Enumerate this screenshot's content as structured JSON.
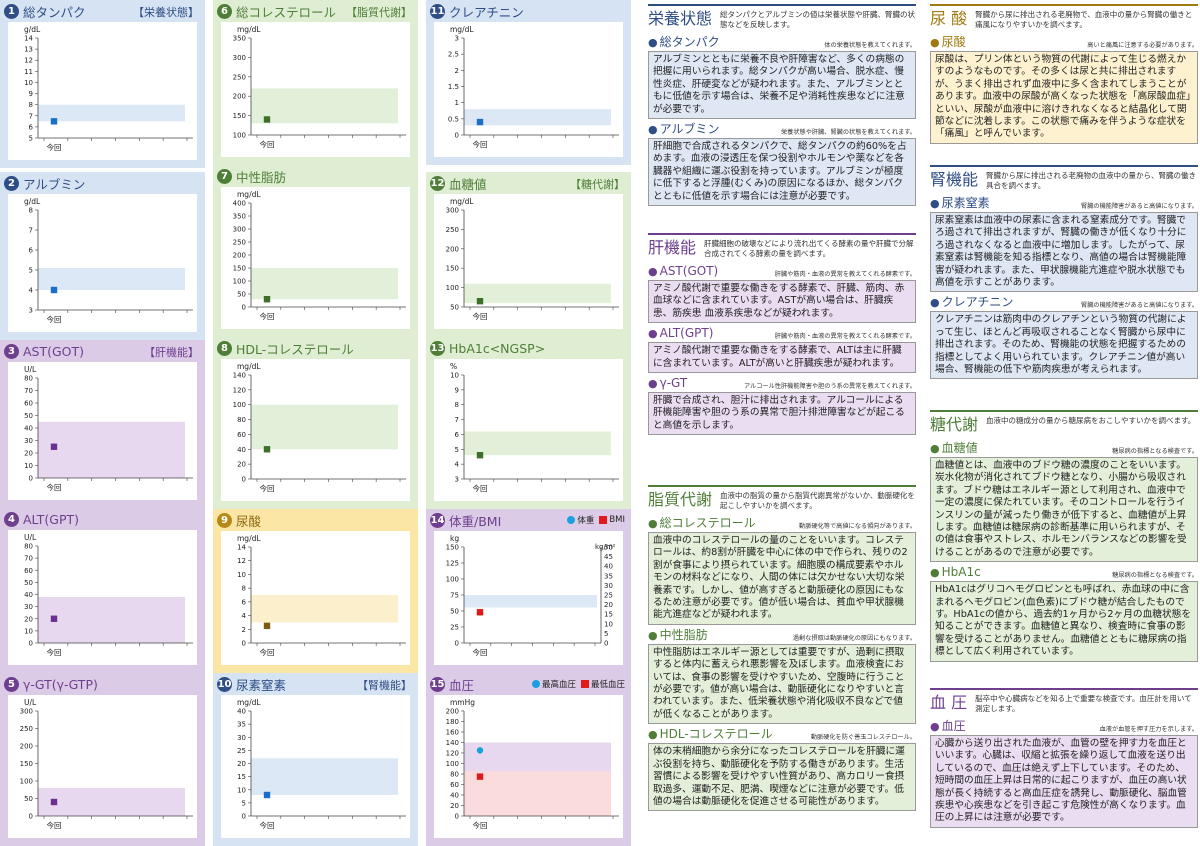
{
  "colors": {
    "blue": "#2f4e86",
    "blue_bg": "#d6e3f3",
    "blue_band": "#dce8f5",
    "green": "#4f7e38",
    "green_bg": "#dfeed3",
    "green_band": "#e3f0d9",
    "purple": "#6f3f8f",
    "purple_bg": "#dccbe6",
    "purple_band": "#e7d8ef",
    "yellow": "#b58a18",
    "yellow_bg": "#fce6a6",
    "yellow_band": "#fcefcc",
    "pink_band": "#fbdcdc",
    "point_blue": "#1a6fc8",
    "point_green": "#3d6e2a",
    "point_purple": "#6a3090",
    "point_brown": "#7a5a10",
    "marker_cyan": "#1aa0e0",
    "marker_red": "#e01a1a"
  },
  "x_label": "今回",
  "tiles": [
    {
      "num": "1",
      "title": "総タンパク",
      "category": "【栄養状態】",
      "unit": "g/dL",
      "color": "blue",
      "chart_data": {
        "type": "scatter",
        "ylim": [
          5,
          14
        ],
        "ticks": [
          5,
          6,
          7,
          8,
          9,
          10,
          11,
          12,
          13,
          14
        ],
        "band": [
          6.5,
          8.0
        ],
        "points": [
          {
            "x": "今回",
            "y": 6.5
          }
        ]
      }
    },
    {
      "num": "2",
      "title": "アルブミン",
      "category": "",
      "unit": "g/dL",
      "color": "blue",
      "chart_data": {
        "type": "scatter",
        "ylim": [
          3,
          8
        ],
        "ticks": [
          3,
          4,
          5,
          6,
          7,
          8
        ],
        "band": [
          4.0,
          5.1
        ],
        "points": [
          {
            "x": "今回",
            "y": 4.0
          }
        ]
      }
    },
    {
      "num": "3",
      "title": "AST(GOT)",
      "category": "【肝機能】",
      "unit": "U/L",
      "color": "purple",
      "chart_data": {
        "type": "scatter",
        "ylim": [
          0,
          80
        ],
        "ticks": [
          0,
          10,
          20,
          30,
          40,
          50,
          60,
          70,
          80
        ],
        "band": [
          0,
          45
        ],
        "points": [
          {
            "x": "今回",
            "y": 25
          }
        ]
      }
    },
    {
      "num": "4",
      "title": "ALT(GPT)",
      "category": "",
      "unit": "U/L",
      "color": "purple",
      "chart_data": {
        "type": "scatter",
        "ylim": [
          0,
          80
        ],
        "ticks": [
          0,
          10,
          20,
          30,
          40,
          50,
          60,
          70,
          80
        ],
        "band": [
          0,
          38
        ],
        "points": [
          {
            "x": "今回",
            "y": 20
          }
        ]
      }
    },
    {
      "num": "5",
      "title": "γ-GT(γ-GTP)",
      "category": "",
      "unit": "U/L",
      "color": "purple",
      "chart_data": {
        "type": "scatter",
        "ylim": [
          0,
          300
        ],
        "ticks": [
          0,
          50,
          100,
          150,
          200,
          250,
          300
        ],
        "band": [
          0,
          80
        ],
        "points": [
          {
            "x": "今回",
            "y": 40
          }
        ]
      }
    },
    {
      "num": "6",
      "title": "総コレステロール",
      "category": "【脂質代謝】",
      "unit": "mg/dL",
      "color": "green",
      "chart_data": {
        "type": "scatter",
        "ylim": [
          100,
          350
        ],
        "ticks": [
          100,
          150,
          200,
          250,
          300,
          350
        ],
        "band": [
          130,
          220
        ],
        "points": [
          {
            "x": "今回",
            "y": 140
          }
        ]
      }
    },
    {
      "num": "7",
      "title": "中性脂肪",
      "category": "",
      "unit": "mg/dL",
      "color": "green",
      "chart_data": {
        "type": "scatter",
        "ylim": [
          0,
          400
        ],
        "ticks": [
          0,
          50,
          100,
          150,
          200,
          250,
          300,
          350,
          400
        ],
        "band": [
          30,
          150
        ],
        "points": [
          {
            "x": "今回",
            "y": 30
          }
        ]
      }
    },
    {
      "num": "8",
      "title": "HDL-コレステロール",
      "category": "",
      "unit": "mg/dL",
      "color": "green",
      "chart_data": {
        "type": "scatter",
        "ylim": [
          0,
          140
        ],
        "ticks": [
          0,
          20,
          40,
          60,
          80,
          100,
          120,
          140
        ],
        "band": [
          40,
          100
        ],
        "points": [
          {
            "x": "今回",
            "y": 40
          }
        ]
      }
    },
    {
      "num": "9",
      "title": "尿酸",
      "category": "",
      "unit": "mg/dL",
      "color": "yellow",
      "chart_data": {
        "type": "scatter",
        "ylim": [
          0,
          14
        ],
        "ticks": [
          0,
          2,
          4,
          6,
          8,
          10,
          12,
          14
        ],
        "band": [
          3.0,
          7.0
        ],
        "points": [
          {
            "x": "今回",
            "y": 2.5
          }
        ]
      }
    },
    {
      "num": "10",
      "title": "尿素窒素",
      "category": "【腎機能】",
      "unit": "mg/dL",
      "color": "blue",
      "chart_data": {
        "type": "scatter",
        "ylim": [
          0,
          40
        ],
        "ticks": [
          0,
          5,
          10,
          15,
          20,
          25,
          30,
          35,
          40
        ],
        "band": [
          8,
          22
        ],
        "points": [
          {
            "x": "今回",
            "y": 8
          }
        ]
      }
    },
    {
      "num": "11",
      "title": "クレアチニン",
      "category": "",
      "unit": "mg/dL",
      "color": "blue",
      "chart_data": {
        "type": "scatter",
        "ylim": [
          0,
          3
        ],
        "ticks": [
          0,
          0.5,
          1,
          1.5,
          2,
          2.5,
          3
        ],
        "band": [
          0.3,
          0.8
        ],
        "points": [
          {
            "x": "今回",
            "y": 0.4
          }
        ]
      }
    },
    {
      "num": "12",
      "title": "血糖値",
      "category": "【糖代謝】",
      "unit": "mg/dL",
      "color": "green",
      "chart_data": {
        "type": "scatter",
        "ylim": [
          50,
          300
        ],
        "ticks": [
          50,
          100,
          150,
          200,
          250,
          300
        ],
        "band": [
          60,
          110
        ],
        "points": [
          {
            "x": "今回",
            "y": 65
          }
        ]
      }
    },
    {
      "num": "13",
      "title": "HbA1c<NGSP>",
      "category": "",
      "unit": "%",
      "color": "green",
      "chart_data": {
        "type": "scatter",
        "ylim": [
          3,
          10
        ],
        "ticks": [
          3,
          4,
          5,
          6,
          7,
          8,
          9,
          10
        ],
        "band": [
          4.6,
          6.2
        ],
        "points": [
          {
            "x": "今回",
            "y": 4.6
          }
        ]
      }
    },
    {
      "num": "14",
      "title": "体重/BMI",
      "category": "",
      "unit": "kg",
      "unit_right": "kg/m²",
      "color": "purple",
      "legend": [
        {
          "label": "体重",
          "shape": "circle",
          "color": "#1aa0e0"
        },
        {
          "label": "BMI",
          "shape": "square",
          "color": "#e01a1a"
        }
      ],
      "chart_data": {
        "type": "scatter",
        "ylim": [
          0,
          150
        ],
        "ticks": [
          0,
          25,
          50,
          75,
          100,
          125,
          150
        ],
        "y2lim": [
          0,
          50
        ],
        "ticks2": [
          0,
          5,
          10,
          15,
          20,
          25,
          30,
          35,
          40,
          45,
          50
        ],
        "band2": [
          18.5,
          25
        ],
        "points": [
          {
            "x": "今回",
            "y": 48,
            "series": "体重"
          },
          {
            "x": "今回",
            "y2": 16,
            "series": "BMI"
          }
        ]
      }
    },
    {
      "num": "15",
      "title": "血圧",
      "category": "",
      "unit": "mmHg",
      "color": "purple",
      "legend": [
        {
          "label": "最高血圧",
          "shape": "circle",
          "color": "#1aa0e0"
        },
        {
          "label": "最低血圧",
          "shape": "square",
          "color": "#e01a1a"
        }
      ],
      "chart_data": {
        "type": "scatter",
        "ylim": [
          0,
          200
        ],
        "ticks": [
          0,
          20,
          40,
          60,
          80,
          100,
          120,
          140,
          160,
          180,
          200
        ],
        "band": [
          0,
          140
        ],
        "band_low": [
          0,
          85
        ],
        "points": [
          {
            "x": "今回",
            "y": 125,
            "series": "最高血圧"
          },
          {
            "x": "今回",
            "y": 75,
            "series": "最低血圧"
          }
        ]
      }
    }
  ],
  "sections": {
    "nutrition": {
      "title": "栄養状態",
      "desc": "総タンパクとアルブミンの値は栄養状態や肝臓、腎臓の状態などを反映します。",
      "items": [
        {
          "name": "総タンパク",
          "note": "体の栄養状態を教えてくれます。",
          "body": "アルブミンとともに栄養不良や肝障害など、多くの病態の把握に用いられます。総タンパクが高い場合、脱水症、慢性炎症、肝硬変などが疑われます。また、アルブミンとともに低値を示す場合は、栄養不足や消耗性疾患などに注意が必要です。"
        },
        {
          "name": "アルブミン",
          "note": "栄養状態や肝臓、腎臓の状態を教えてくれます。",
          "body": "肝細胞で合成されるタンパクで、総タンパクの約60%を占めます。血液の浸透圧を保つ役割やホルモンや薬などを各臓器や組織に運ぶ役割を持っています。アルブミンが極度に低下すると浮腫(むくみ)の原因になるほか、総タンパクとともに低値を示す場合には注意が必要です。"
        }
      ]
    },
    "liver": {
      "title": "肝機能",
      "desc": "肝臓細胞の破壊などにより流れ出てくる酵素の量や肝臓で分解合成されてくる酵素の量を調べます。",
      "items": [
        {
          "name": "AST(GOT)",
          "note": "肝臓や筋肉・血液の異常を教えてくれる酵素です。",
          "body": "アミノ酸代謝で重要な働きをする酵素で、肝臓、筋肉、赤血球などに含まれています。ASTが高い場合は、肝臓疾患、筋疾患 血液系疾患などが疑われます。"
        },
        {
          "name": "ALT(GPT)",
          "note": "肝臓や筋肉・血液の異常を教えてくれる酵素です。",
          "body": "アミノ酸代謝で重要な働きをする酵素で、ALTは主に肝臓に含まれています。ALTが高いと肝臓疾患が疑われます。"
        },
        {
          "name": "γ-GT",
          "note": "アルコール性肝機能障害や胆のう系の異常を教えてくれます。",
          "body": "肝臓で合成され、胆汁に排出されます。アルコールによる肝機能障害や胆のう系の異常で胆汁排泄障害などが起こると高値を示します。"
        }
      ]
    },
    "lipid": {
      "title": "脂質代謝",
      "desc": "血液中の脂質の量から脂質代謝異常がないか、動脈硬化を起こしやすいかを調べます。",
      "items": [
        {
          "name": "総コレステロール",
          "note": "動脈硬化等で高値になる傾向があります。",
          "body": "血液中のコレステロールの量のことをいいます。コレステロールは、約8割が肝臓を中心に体の中で作られ、残りの2割が食事により摂られています。細胞膜の構成要素やホルモンの材料などになり、人間の体には欠かせない大切な栄養素です。しかし、値が高すぎると動脈硬化の原因にもなるため注意が必要です。値が低い場合は、貧血や甲状腺機能亢進症などが疑われます。"
        },
        {
          "name": "中性脂肪",
          "note": "過剰な摂取は動脈硬化の原因にもなります。",
          "body": "中性脂肪はエネルギー源としては重要ですが、過剰に摂取すると体内に蓄えられ悪影響を及ぼします。血液検査においては、食事の影響を受けやすいため、空腹時に行うことが必要です。値が高い場合は、動脈硬化になりやすいと言われています。また、低栄養状態や消化吸収不良などで値が低くなることがあります。"
        },
        {
          "name": "HDL-コレステロール",
          "note": "動脈硬化を防ぐ善玉コレステロール。",
          "body": "体の末梢細胞から余分になったコレステロールを肝臓に運ぶ役割を持ち、動脈硬化を予防する働きがあります。生活習慣による影響を受けやすい性質があり、高カロリー食摂取過多、運動不足、肥満、喫煙などに注意が必要です。低値の場合は動脈硬化を促進させる可能性があります。"
        }
      ]
    },
    "uric": {
      "title": "尿 酸",
      "desc": "腎臓から尿に排出される老廃物で、血液中の量から腎臓の働きと痛風になりやすいかを調べます。",
      "items": [
        {
          "name": "尿酸",
          "note": "高いと痛風に注意する必要があります。",
          "body": "尿酸は、プリン体という物質の代謝によって生じる燃えかすのようなものです。その多くは尿と共に排出されますが、うまく排出されず血液中に多く含まれてしまうことがあります。血液中の尿酸が高くなった状態を「高尿酸血症」といい、尿酸が血液中に溶けきれなくなると結晶化して関節などに沈着します。この状態で痛みを伴うような症状を「痛風」と呼んでいます。"
        }
      ]
    },
    "kidney": {
      "title": "腎機能",
      "desc": "腎臓から尿に排出される老廃物の血液中の量から、腎臓の働き具合を調べます。",
      "items": [
        {
          "name": "尿素窒素",
          "note": "腎臓の機能障害があると高値になります。",
          "body": "尿素窒素は血液中の尿素に含まれる窒素成分です。腎臓でろ過されて排出されますが、腎臓の働きが低くなり十分にろ過されなくなると血液中に増加します。したがって、尿素窒素は腎機能を知る指標となり、高値の場合は腎機能障害が疑われます。また、甲状腺機能亢進症や脱水状態でも高値を示すことがあります。"
        },
        {
          "name": "クレアチニン",
          "note": "腎臓の機能障害があると高値になります。",
          "body": "クレアチニンは筋肉中のクレアチンという物質の代謝によって生じ、ほとんど再吸収されることなく腎臓から尿中に排出されます。そのため、腎機能の状態を把握するための指標としてよく用いられています。クレアチニン値が高い場合、腎機能の低下や筋肉疾患が考えられます。"
        }
      ]
    },
    "sugar": {
      "title": "糖代謝",
      "desc": "血液中の糖成分の量から糖尿病をおこしやすいかを調べます。",
      "items": [
        {
          "name": "血糖値",
          "note": "糖尿病の指標となる検査です。",
          "body": "血糖値とは、血液中のブドウ糖の濃度のことをいいます。炭水化物が消化されてブドウ糖となり、小腸から吸収されます。ブドウ糖はエネルギー源として利用され、血液中で一定の濃度に保たれています。そのコントロールを行うインスリンの量が減ったり働きが低下すると、血糖値が上昇します。血糖値は糖尿病の診断基準に用いられますが、その値は食事やストレス、ホルモンバランスなどの影響を受けることがあるので注意が必要です。"
        },
        {
          "name": "HbA1c",
          "note": "糖尿病の指標となる検査です。",
          "body": "HbA1cはグリコヘモグロビンとも呼ばれ、赤血球の中に含まれるヘモグロビン(血色素)にブドウ糖が結合したものです。HbA1cの値から、過去約1ヶ月から2ヶ月の血糖状態を知ることができます。血糖値と異なり、検査時に食事の影響を受けることがありません。血糖値とともに糖尿病の指標として広く利用されています。"
        }
      ]
    },
    "bp": {
      "title": "血 圧",
      "desc": "脳卒中や心臓病などを知る上で重要な検査です。血圧計を用いて測定します。",
      "items": [
        {
          "name": "血圧",
          "note": "血液が血管を押す圧力を示します。",
          "body": "心臓から送り出された血液が、血管の壁を押す力を血圧といいます。心臓は、収縮と拡張を繰り返して血液を送り出しているので、血圧は絶えず上下しています。そのため、短時間の血圧上昇は日常的に起こりますが、血圧の高い状態が長く持続すると高血圧症を誘発し、動脈硬化、脳血管疾患や心疾患などを引き起こす危険性が高くなります。血圧の上昇には注意が必要です。"
        }
      ]
    }
  }
}
